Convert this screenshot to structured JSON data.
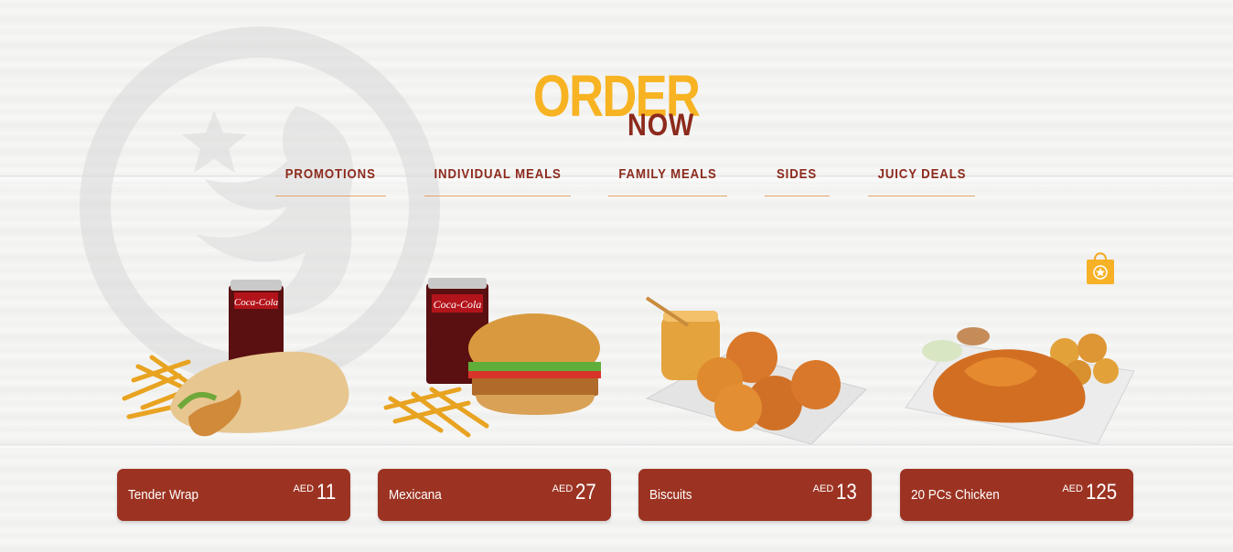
{
  "title": {
    "order": "ORDER",
    "now": "NOW"
  },
  "nav": [
    {
      "label": "PROMOTIONS"
    },
    {
      "label": "INDIVIDUAL MEALS"
    },
    {
      "label": "FAMILY MEALS"
    },
    {
      "label": "SIDES"
    },
    {
      "label": "JUICY DEALS"
    }
  ],
  "products": [
    {
      "name": "Tender Wrap",
      "currency": "AED",
      "price": "11",
      "image": "wrap-fries-cola-image"
    },
    {
      "name": "Mexicana",
      "currency": "AED",
      "price": "27",
      "image": "burger-fries-cola-image"
    },
    {
      "name": "Biscuits",
      "currency": "AED",
      "price": "13",
      "image": "biscuits-honey-image"
    },
    {
      "name": "20 PCs Chicken",
      "currency": "AED",
      "price": "125",
      "image": "chicken-bucket-image"
    }
  ],
  "icons": {
    "cart": "shopping-bag-icon",
    "watermark": "rooster-logo-icon"
  },
  "colors": {
    "accent": "#f7b322",
    "brand": "#8c2a1c",
    "card": "#9c3322"
  }
}
